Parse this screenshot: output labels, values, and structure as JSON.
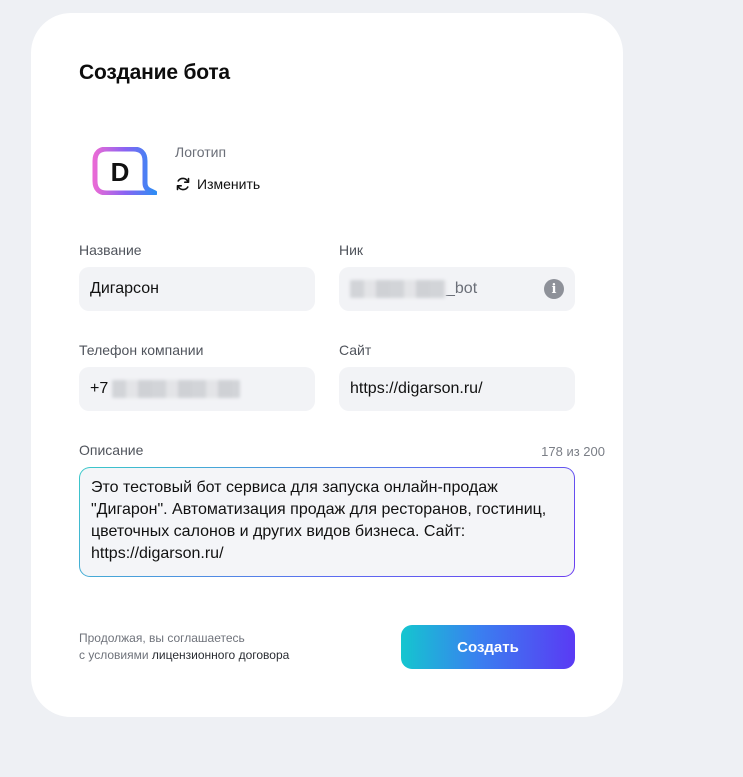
{
  "form": {
    "title": "Создание бота",
    "logo": {
      "label": "Логотип",
      "change_label": "Изменить",
      "logo_letter": "D",
      "icons": [
        "bot-logo-icon",
        "refresh-icon"
      ]
    },
    "name": {
      "label": "Название",
      "value": "Дигарсон"
    },
    "nick": {
      "label": "Ник",
      "suffix": "_bot",
      "info_icon": "info-icon"
    },
    "phone": {
      "label": "Телефон компании",
      "prefix": "+7"
    },
    "site": {
      "label": "Сайт",
      "value": "https://digarson.ru/"
    },
    "description": {
      "label": "Описание",
      "counter": "178 из 200",
      "value": "Это тестовый бот сервиса для запуска онлайн-продаж \"Дигарон\". Автоматизация продаж для ресторанов, гостиниц, цветочных салонов и других видов бизнеса. Сайт: https://digarson.ru/"
    },
    "consent": {
      "line1": "Продолжая, вы соглашаетесь",
      "line2_prefix": "с условиями",
      "line2_link": "лицензионного договора"
    },
    "submit_label": "Создать"
  },
  "colors": {
    "background": "#eef0f4",
    "card": "#ffffff",
    "input_bg": "#f2f3f6",
    "button_gradient_start": "#14c6cf",
    "button_gradient_end": "#5a3af4"
  }
}
